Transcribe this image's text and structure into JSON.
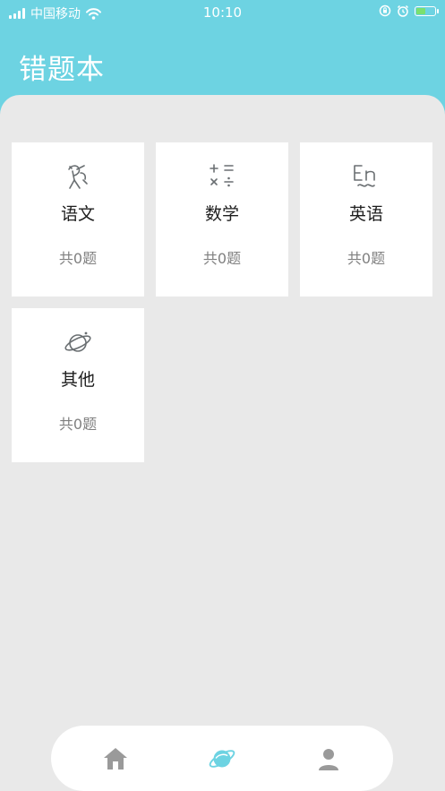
{
  "status_bar": {
    "carrier": "中国移动",
    "time": "10:10"
  },
  "header": {
    "title": "错题本"
  },
  "subjects": [
    {
      "name": "语文",
      "count": "共0题",
      "icon": "chinese-icon"
    },
    {
      "name": "数学",
      "count": "共0题",
      "icon": "math-symbols-icon"
    },
    {
      "name": "英语",
      "count": "共0题",
      "icon": "english-icon"
    },
    {
      "name": "其他",
      "count": "共0题",
      "icon": "planet-icon"
    }
  ],
  "tabbar": {
    "items": [
      {
        "icon": "home-icon",
        "active": false
      },
      {
        "icon": "planet-icon",
        "active": true
      },
      {
        "icon": "profile-icon",
        "active": false
      }
    ],
    "active_color": "#6dd3e2",
    "inactive_color": "#9a9a9a"
  },
  "colors": {
    "accent": "#6dd3e2",
    "background": "#e9e9e9"
  }
}
